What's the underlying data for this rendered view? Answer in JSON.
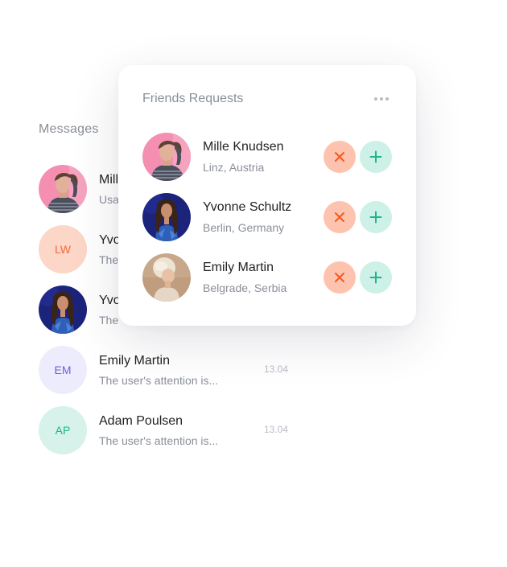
{
  "messages": {
    "title": "Messages",
    "items": [
      {
        "name": "Mill",
        "preview": "Usa",
        "time": "",
        "avatar_type": "photo",
        "photo": "pink-man"
      },
      {
        "name": "Yvo",
        "preview": "The",
        "time": "",
        "avatar_type": "initials",
        "initials": "LW",
        "bg": "#fcd6c6",
        "fg": "#f26a3e"
      },
      {
        "name": "Yvo",
        "preview": "The",
        "time": "",
        "avatar_type": "photo",
        "photo": "blue-woman"
      },
      {
        "name": "Emily Martin",
        "preview": "The user's attention is...",
        "time": "13.04",
        "avatar_type": "initials",
        "initials": "EM",
        "bg": "#ececfd",
        "fg": "#6e5fdc"
      },
      {
        "name": "Adam Poulsen",
        "preview": "The user's attention is...",
        "time": "13.04",
        "avatar_type": "initials",
        "initials": "AP",
        "bg": "#d6f2ea",
        "fg": "#1fb58a"
      }
    ]
  },
  "friend_requests": {
    "title": "Friends Requests",
    "more_icon": "more-horizontal-icon",
    "decline_icon": "close-icon",
    "accept_icon": "plus-icon",
    "requests": [
      {
        "name": "Mille Knudsen",
        "location": "Linz, Austria",
        "photo": "pink-man"
      },
      {
        "name": "Yvonne Schultz",
        "location": "Berlin, Germany",
        "photo": "blue-woman"
      },
      {
        "name": "Emily Martin",
        "location": "Belgrade, Serbia",
        "photo": "beige-woman"
      }
    ]
  },
  "colors": {
    "decline_bg": "#fdc3ae",
    "decline_icon": "#f25a1f",
    "accept_bg": "#cdf0e7",
    "accept_icon": "#1fb58a",
    "muted_text": "#8a8f98"
  }
}
